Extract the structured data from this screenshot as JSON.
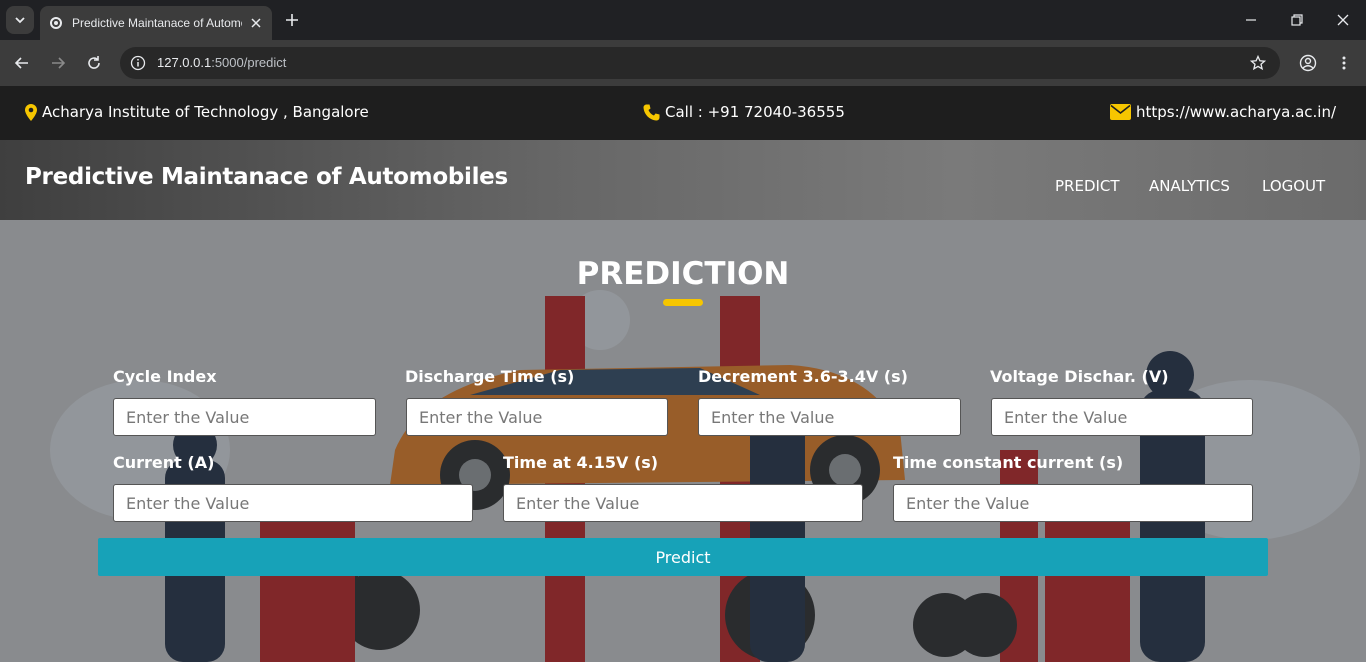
{
  "browser": {
    "tab_title": "Predictive Maintanace of Automobiles",
    "url_host": "127.0.0.1",
    "url_path": ":5000/predict"
  },
  "topbar": {
    "location": "Acharya Institute of Technology , Bangalore",
    "phone": "Call : +91 72040-36555",
    "website": "https://www.acharya.ac.in/"
  },
  "navbar": {
    "brand": "Predictive Maintanace of Automobiles",
    "links": [
      "PREDICT",
      "ANALYTICS",
      "LOGOUT"
    ]
  },
  "form": {
    "title": "PREDICTION",
    "fields": [
      {
        "label": "Cycle Index",
        "placeholder": "Enter the Value"
      },
      {
        "label": "Discharge Time (s)",
        "placeholder": "Enter the Value"
      },
      {
        "label": "Decrement 3.6-3.4V (s)",
        "placeholder": "Enter the Value"
      },
      {
        "label": "Voltage Dischar. (V)",
        "placeholder": "Enter the Value"
      },
      {
        "label": "Current (A)",
        "placeholder": "Enter the Value"
      },
      {
        "label": "Time at 4.15V (s)",
        "placeholder": "Enter the Value"
      },
      {
        "label": "Time constant current (s)",
        "placeholder": "Enter the Value"
      }
    ],
    "submit_label": "Predict"
  },
  "colors": {
    "accent_yellow": "#f6c600",
    "button_teal": "#17a2b8",
    "topbar_bg": "#1e1e1e"
  },
  "icons": {
    "location": "map-marker-icon",
    "phone": "phone-icon",
    "email": "envelope-icon"
  }
}
